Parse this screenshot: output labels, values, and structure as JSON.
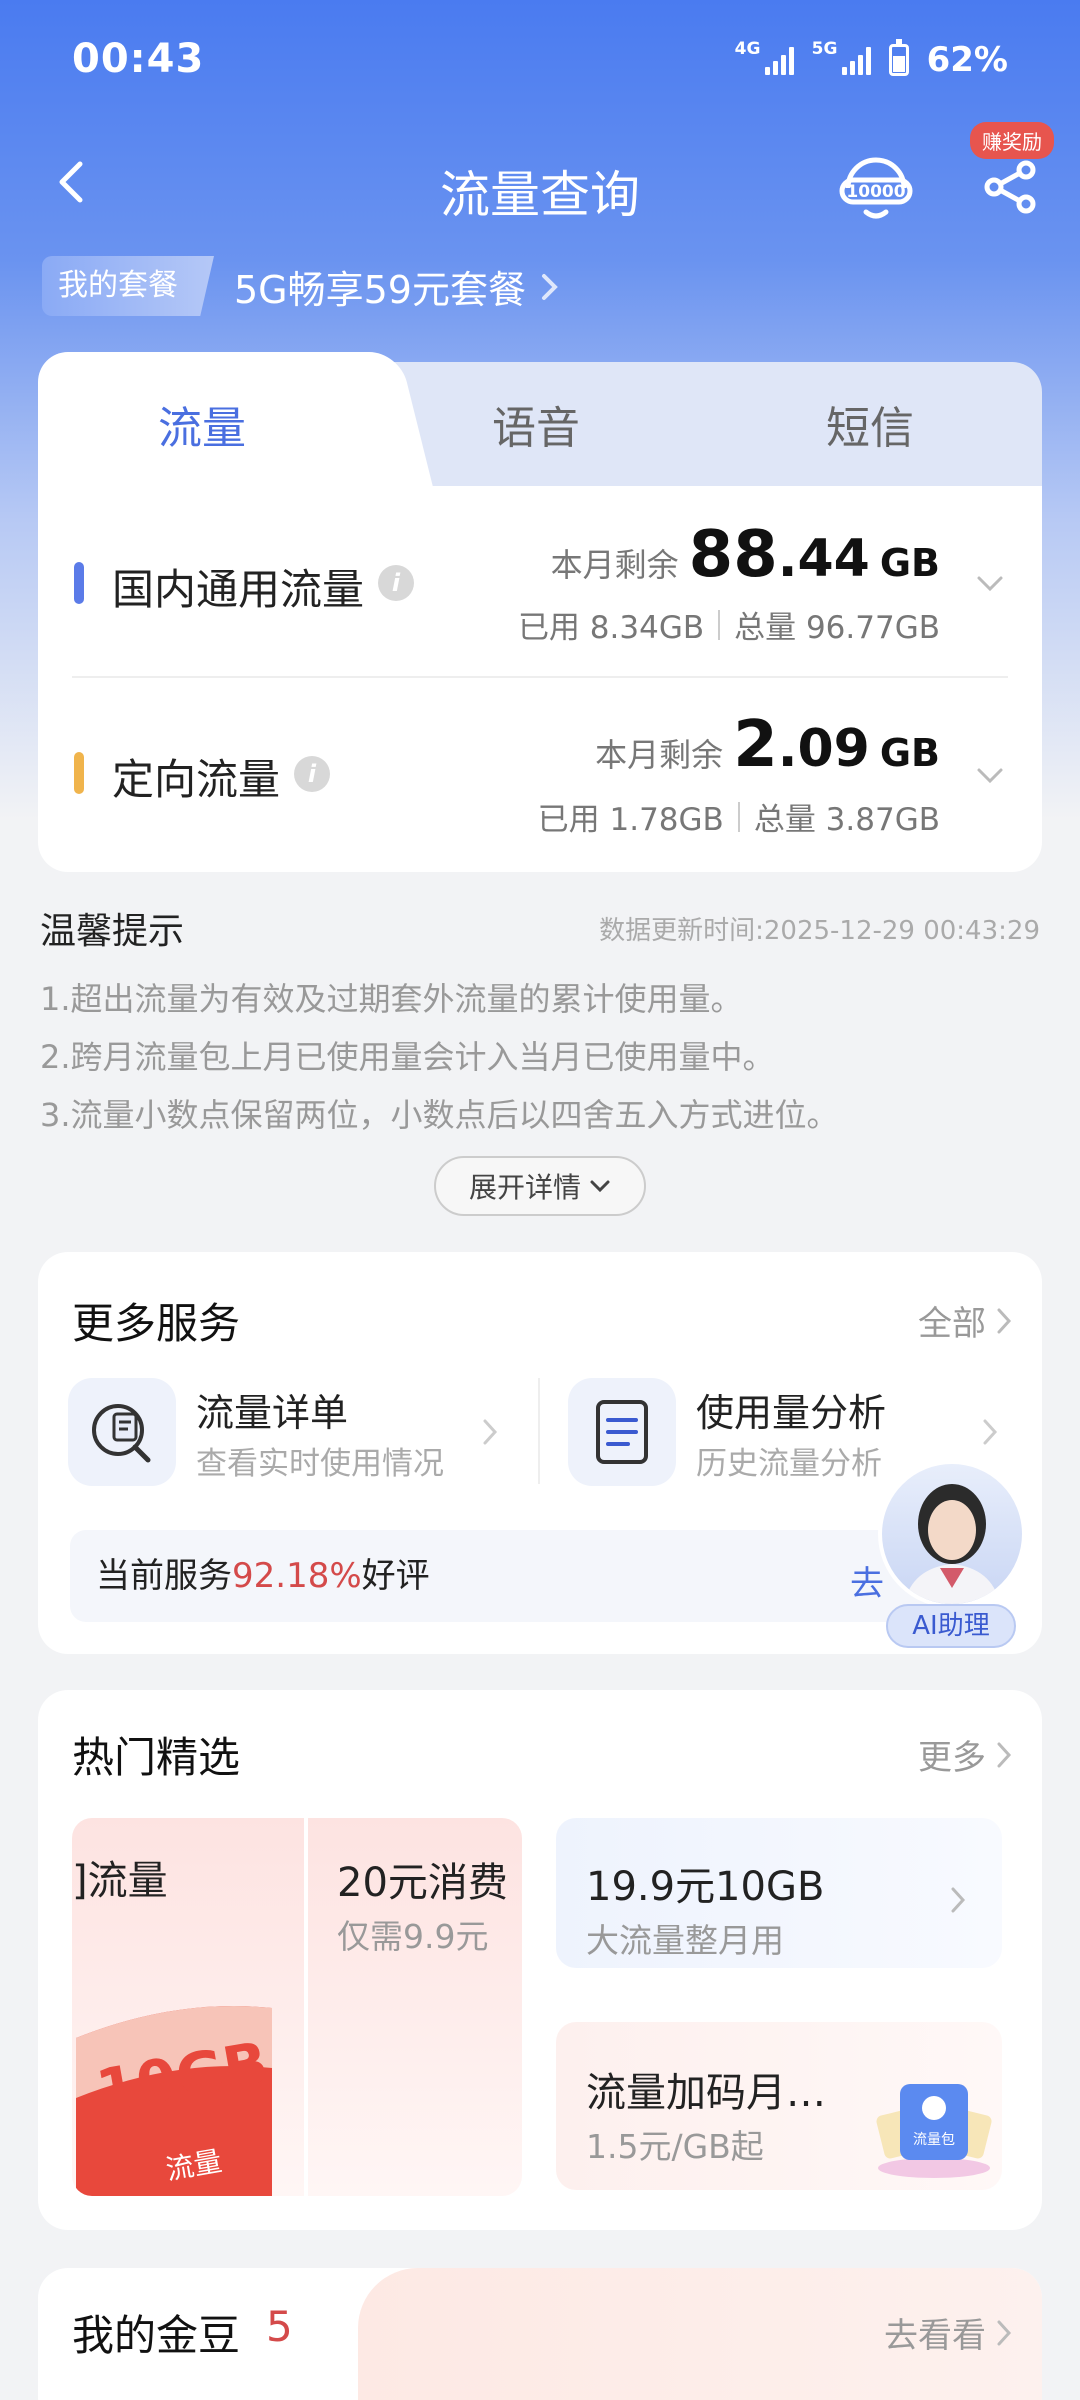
{
  "status": {
    "time": "00:43",
    "net1": "4G",
    "net2": "5G",
    "battery": "62%"
  },
  "header": {
    "title": "流量查询",
    "reward_badge": "赚奖励",
    "service_number": "10000"
  },
  "plan": {
    "tag": "我的套餐",
    "name": "5G畅享59元套餐"
  },
  "tabs": [
    {
      "label": "流量"
    },
    {
      "label": "语音"
    },
    {
      "label": "短信"
    }
  ],
  "usage": [
    {
      "label": "国内通用流量",
      "remain_label": "本月剩余",
      "remain_int": "88",
      "remain_dec": ".44",
      "unit": "GB",
      "used": "已用 8.34GB",
      "total": "总量 96.77GB",
      "color": "#5b7be8"
    },
    {
      "label": "定向流量",
      "remain_label": "本月剩余",
      "remain_int": "2",
      "remain_dec": ".09",
      "unit": "GB",
      "used": "已用 1.78GB",
      "total": "总量 3.87GB",
      "color": "#f0b44c"
    }
  ],
  "tips": {
    "title": "温馨提示",
    "update_time": "数据更新时间:2025-12-29 00:43:29",
    "lines": [
      "1.超出流量为有效及过期套外流量的累计使用量。",
      "2.跨月流量包上月已使用量会计入当月已使用量中。",
      "3.流量小数点保留两位，小数点后以四舍五入方式进位。"
    ],
    "expand": "展开详情"
  },
  "services": {
    "title": "更多服务",
    "all": "全部",
    "items": [
      {
        "name": "流量详单",
        "sub": "查看实时使用情况"
      },
      {
        "name": "使用量分析",
        "sub": "历史流量分析"
      }
    ],
    "rating_prefix": "当前服务",
    "rating_pct": "92.18%",
    "rating_suffix": "好评",
    "rating_go": "去",
    "ai_label": "AI助理"
  },
  "hot": {
    "title": "热门精选",
    "more": "更多",
    "left_title": "]流量",
    "left_art": "10GB",
    "left_art_sub": "流量",
    "mid_title": "20元消费",
    "mid_sub": "仅需9.9元",
    "right1_title": "19.9元10GB",
    "right1_sub": "大流量整月用",
    "right2_title": "流量加码月…",
    "right2_sub": "1.5元/GB起",
    "pack_label": "流量包"
  },
  "gold": {
    "title": "我的金豆",
    "count": "5",
    "link": "去看看"
  }
}
